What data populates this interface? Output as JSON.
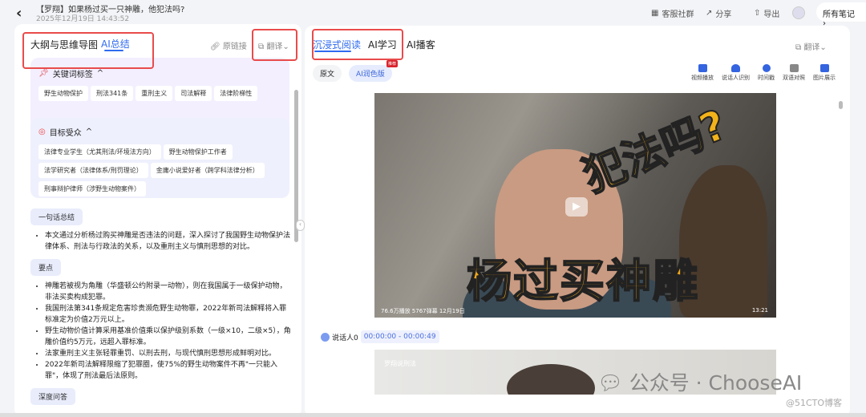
{
  "header": {
    "back_icon": "chevron-left-icon",
    "title": "【罗翔】如果杨过买一只神雕，他犯法吗?",
    "date": "2025年12月19日 14:43:52",
    "service": "客服社群",
    "share": "分享",
    "export": "导出",
    "all_notes": "所有笔记"
  },
  "left": {
    "tabs": [
      {
        "label": "大纲与思维导图"
      },
      {
        "label": "AI总结"
      }
    ],
    "original_link": "原链接",
    "translate": "翻译",
    "keywords": {
      "title": "关键词标签",
      "chips": [
        "野生动物保护",
        "刑法341条",
        "重刑主义",
        "司法解释",
        "法律阶梯性"
      ]
    },
    "audience": {
      "title": "目标受众",
      "chips": [
        "法律专业学生（尤其刑法/环境法方向）",
        "野生动物保护工作者",
        "法学研究者（法律体系/刑罚理论）",
        "金庸小说爱好者（跨学科法律分析）",
        "刑事辩护律师（涉野生动物案件）"
      ]
    },
    "summary": {
      "title": "一句话总结",
      "items": [
        "本文通过分析杨过购买神雕是否违法的问题，深入探讨了我国野生动物保护法律体系、刑法与行政法的关系，以及重刑主义与慎刑思想的对比。"
      ]
    },
    "points": {
      "title": "要点",
      "items": [
        "神雕若被视为角雕（华盛顿公约附录一动物），则在我国属于一级保护动物，非法买卖构成犯罪。",
        "我国刑法第341条规定危害珍贵濒危野生动物罪，2022年新司法解释将入罪标准定为价值2万元以上。",
        "野生动物价值计算采用基准价值乘以保护级别系数（一级×10，二级×5），角雕价值约5万元，远超入罪标准。",
        "法家重刑主义主张轻罪重罚、以刑去刑，与现代慎刑思想形成鲜明对比。",
        "2022年新司法解释限缩了犯罪圈，使75%的野生动物案件不再\"一只能入罪\"，体现了刑法最后法原则。"
      ]
    },
    "qa": {
      "title": "深度问答"
    }
  },
  "right": {
    "tabs": [
      {
        "label": "沉浸式阅读"
      },
      {
        "label": "AI学习"
      },
      {
        "label": "AI播客"
      }
    ],
    "translate": "翻译",
    "modes": {
      "original": "原文",
      "polished": "AI润色版",
      "badge": "推荐"
    },
    "tools": [
      {
        "label": "视频播放",
        "icon": "video-icon"
      },
      {
        "label": "说话人识别",
        "icon": "speaker-icon"
      },
      {
        "label": "时间戳",
        "icon": "clock-icon"
      },
      {
        "label": "双语对照",
        "icon": "bilingual-icon"
      },
      {
        "label": "图片展示",
        "icon": "image-icon"
      }
    ],
    "video": {
      "overlay_top": "犯法吗?",
      "overlay_bottom": "杨过买神雕",
      "meta": "76.6万播放  5767弹幕  12月19日",
      "duration": "13:21"
    },
    "speaker": "说话人0",
    "timestamp": "00:00:00 - 00:00:49",
    "img2_caption": "罗翔说刑法"
  },
  "watermark": {
    "main": "公众号 · ChooseAI",
    "sub": "@51CTO博客"
  }
}
